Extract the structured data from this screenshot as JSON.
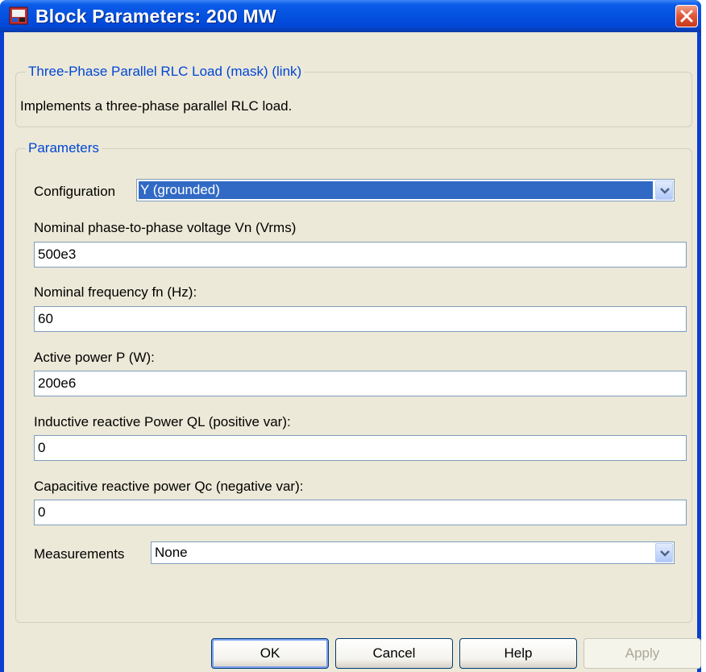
{
  "window": {
    "title": "Block Parameters: 200 MW"
  },
  "mask_group": {
    "legend": "Three-Phase Parallel RLC Load (mask) (link)",
    "description": "Implements a three-phase parallel RLC load."
  },
  "parameters": {
    "legend": "Parameters",
    "configuration": {
      "label": "Configuration",
      "value": "Y (grounded)"
    },
    "voltage": {
      "label": "Nominal phase-to-phase voltage Vn (Vrms)",
      "value": "500e3"
    },
    "frequency": {
      "label": "Nominal frequency fn (Hz):",
      "value": "60"
    },
    "active_power": {
      "label": "Active power P (W):",
      "value": "200e6"
    },
    "inductive_power": {
      "label": "Inductive reactive Power QL (positive var):",
      "value": "0"
    },
    "capacitive_power": {
      "label": "Capacitive reactive power Qc (negative var):",
      "value": "0"
    },
    "measurements": {
      "label": "Measurements",
      "value": "None"
    }
  },
  "buttons": {
    "ok": "OK",
    "cancel": "Cancel",
    "help": "Help",
    "apply": "Apply"
  },
  "colors": {
    "title_bar": "#0451e0",
    "dialog_background": "#ece9d8",
    "group_legend": "#0046d5",
    "selection": "#316ac5",
    "close_button": "#e2593c"
  },
  "icons": {
    "app": "simulink-block-icon",
    "close": "close-icon",
    "dropdown": "chevron-down-icon"
  }
}
